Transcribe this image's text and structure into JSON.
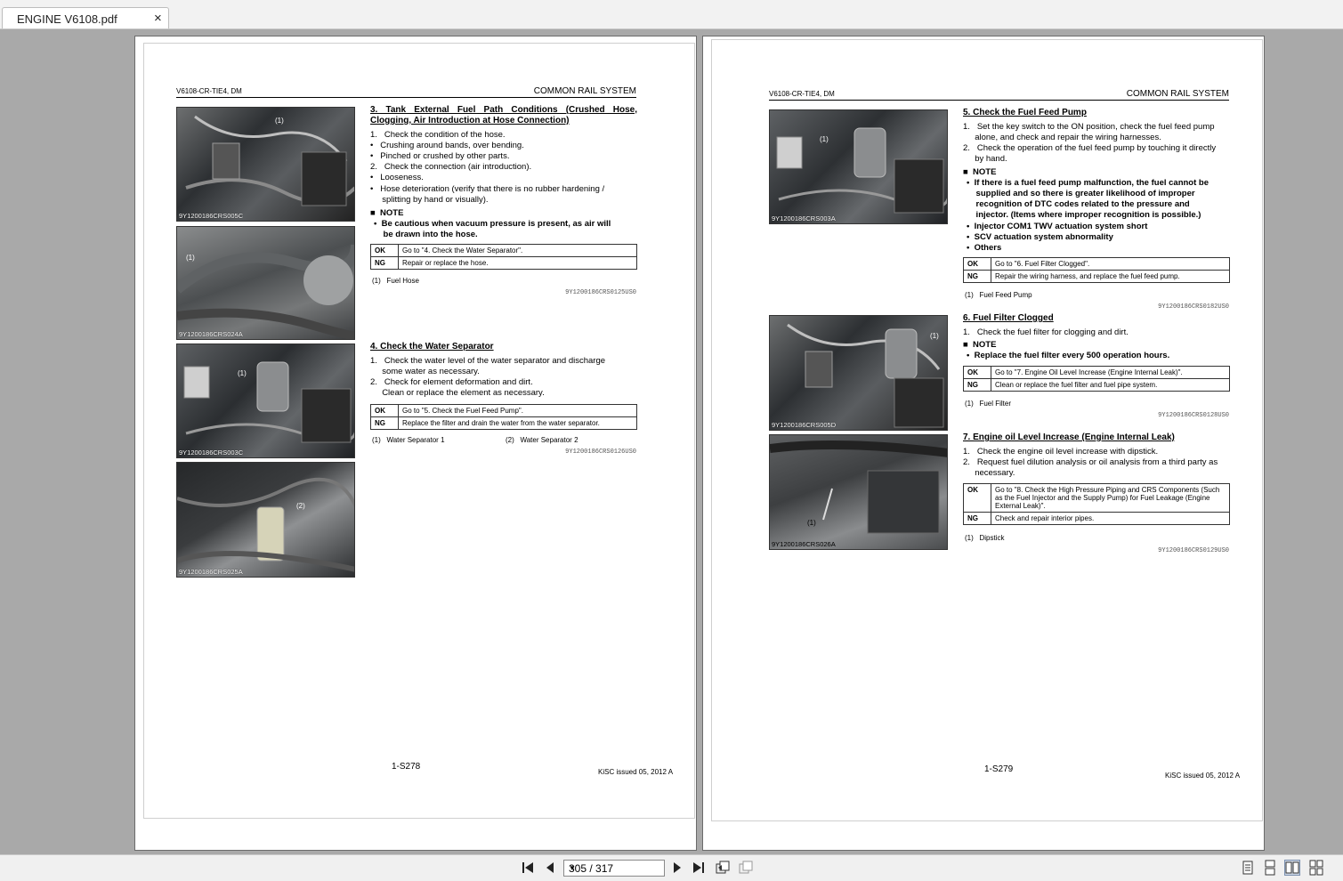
{
  "tab": {
    "title": "ENGINE V6108.pdf",
    "close_glyph": "×"
  },
  "left_page": {
    "header_left": "V6108-CR-TIE4, DM",
    "header_right": "COMMON RAIL SYSTEM",
    "photos": [
      "9Y1200186CRS005C",
      "9Y1200186CRS024A",
      "9Y1200186CRS003C",
      "9Y1200186CRS025A"
    ],
    "callouts": [
      "(1)",
      "(1)",
      "(1)",
      "(2)"
    ],
    "section3": {
      "title_1": "3. Tank External Fuel Path Conditions (Crushed Hose,",
      "title_2": "Clogging, Air Introduction at Hose Connection)",
      "lines": [
        "1.   Check the condition of the hose.",
        "•   Crushing around bands, over bending.",
        "•   Pinched or crushed by other parts.",
        "2.   Check the connection (air introduction).",
        "•   Looseness.",
        "•   Hose deterioration (verify that there is no rubber hardening /",
        "     splitting by hand or visually)."
      ],
      "note": "■  NOTE",
      "note_lines": [
        "•  Be cautious when vacuum pressure is present, as air will",
        "    be drawn into the hose."
      ],
      "ok_key": "OK",
      "ok_text": "Go to \"4. Check the Water Separator\".",
      "ng_key": "NG",
      "ng_text": "Repair or replace the hose.",
      "legend": "(1)   Fuel Hose",
      "ref": "9Y1200186CRS0125US0"
    },
    "section4": {
      "title": "4. Check the Water Separator",
      "lines": [
        "1.   Check the water level of the water separator and discharge",
        "     some water as necessary.",
        "2.   Check for element deformation and dirt.",
        "     Clean or replace the element as necessary."
      ],
      "ok_key": "OK",
      "ok_text": "Go to \"5. Check the Fuel Feed Pump\".",
      "ng_key": "NG",
      "ng_text": "Replace the filter and drain the water from the water separator.",
      "legend_1": "(1)   Water Separator 1",
      "legend_2": "(2)   Water Separator 2",
      "ref": "9Y1200186CRS0126US0"
    },
    "page_number": "1-S278",
    "issued": "KiSC issued 05, 2012 A"
  },
  "right_page": {
    "header_left": "V6108-CR-TIE4, DM",
    "header_right": "COMMON RAIL SYSTEM",
    "photos": [
      "9Y1200186CRS003A",
      "9Y1200186CRS005D",
      "9Y1200186CRS026A"
    ],
    "callouts": [
      "(1)",
      "(1)",
      "(1)"
    ],
    "section5": {
      "title": "5. Check the Fuel Feed Pump",
      "lines": [
        "1.   Set the key switch to the ON position, check the fuel feed pump",
        "     alone, and check and repair the wiring harnesses.",
        "2.   Check the operation of the fuel feed pump by touching it directly",
        "     by hand."
      ],
      "note": "■  NOTE",
      "note_lines": [
        "•  If there is a fuel feed pump malfunction, the fuel cannot be",
        "    supplied and so there is greater likelihood of improper",
        "    recognition of DTC codes related to the pressure and",
        "    injector. (Items where improper recognition is possible.)",
        "•  Injector COM1 TWV actuation system short",
        "•  SCV actuation system abnormality",
        "•  Others"
      ],
      "ok_key": "OK",
      "ok_text": "Go to \"6. Fuel Filter Clogged\".",
      "ng_key": "NG",
      "ng_text": "Repair the wiring harness, and replace the fuel feed pump.",
      "legend": "(1)   Fuel Feed Pump",
      "ref": "9Y1200186CRS0182US0"
    },
    "section6": {
      "title": "6. Fuel Filter Clogged",
      "line": "1.   Check the fuel filter for clogging and dirt.",
      "note": "■  NOTE",
      "note_line": "•  Replace the fuel filter every 500 operation hours.",
      "ok_key": "OK",
      "ok_text": "Go to \"7. Engine Oil Level Increase (Engine Internal Leak)\".",
      "ng_key": "NG",
      "ng_text": "Clean or replace the fuel filter and fuel pipe system.",
      "legend": "(1)   Fuel Filter",
      "ref": "9Y1200186CRS0128US0"
    },
    "section7": {
      "title": "7. Engine oil Level Increase (Engine Internal Leak)",
      "lines": [
        "1.   Check the engine oil level increase with dipstick.",
        "2.   Request fuel dilution analysis or oil analysis from a third party as",
        "     necessary."
      ],
      "ok_key": "OK",
      "ok_text": "Go to \"8. Check the High Pressure Piping and CRS Components (Such as the Fuel Injector and the Supply Pump) for Fuel Leakage (Engine External Leak)\".",
      "ng_key": "NG",
      "ng_text": "Check and repair interior pipes.",
      "legend": "(1)   Dipstick",
      "ref": "9Y1200186CRS0129US0"
    },
    "page_number": "1-S279",
    "issued": "KiSC issued 05, 2012 A"
  },
  "toolbar": {
    "page_indicator": "305 / 317"
  },
  "colors": {
    "background": "#a9a9a9",
    "toolbar": "#f0f0f0",
    "page": "#ffffff"
  }
}
